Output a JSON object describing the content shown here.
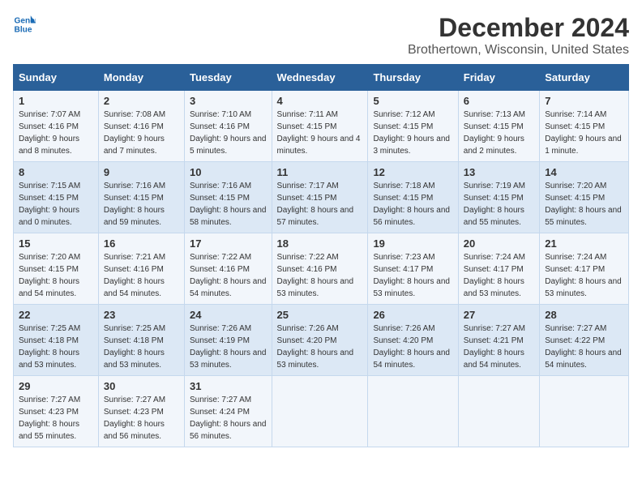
{
  "header": {
    "logo_line1": "General",
    "logo_line2": "Blue",
    "title": "December 2024",
    "subtitle": "Brothertown, Wisconsin, United States"
  },
  "days_of_week": [
    "Sunday",
    "Monday",
    "Tuesday",
    "Wednesday",
    "Thursday",
    "Friday",
    "Saturday"
  ],
  "weeks": [
    [
      {
        "day": "1",
        "sunrise": "7:07 AM",
        "sunset": "4:16 PM",
        "daylight": "9 hours and 8 minutes."
      },
      {
        "day": "2",
        "sunrise": "7:08 AM",
        "sunset": "4:16 PM",
        "daylight": "9 hours and 7 minutes."
      },
      {
        "day": "3",
        "sunrise": "7:10 AM",
        "sunset": "4:16 PM",
        "daylight": "9 hours and 5 minutes."
      },
      {
        "day": "4",
        "sunrise": "7:11 AM",
        "sunset": "4:15 PM",
        "daylight": "9 hours and 4 minutes."
      },
      {
        "day": "5",
        "sunrise": "7:12 AM",
        "sunset": "4:15 PM",
        "daylight": "9 hours and 3 minutes."
      },
      {
        "day": "6",
        "sunrise": "7:13 AM",
        "sunset": "4:15 PM",
        "daylight": "9 hours and 2 minutes."
      },
      {
        "day": "7",
        "sunrise": "7:14 AM",
        "sunset": "4:15 PM",
        "daylight": "9 hours and 1 minute."
      }
    ],
    [
      {
        "day": "8",
        "sunrise": "7:15 AM",
        "sunset": "4:15 PM",
        "daylight": "9 hours and 0 minutes."
      },
      {
        "day": "9",
        "sunrise": "7:16 AM",
        "sunset": "4:15 PM",
        "daylight": "8 hours and 59 minutes."
      },
      {
        "day": "10",
        "sunrise": "7:16 AM",
        "sunset": "4:15 PM",
        "daylight": "8 hours and 58 minutes."
      },
      {
        "day": "11",
        "sunrise": "7:17 AM",
        "sunset": "4:15 PM",
        "daylight": "8 hours and 57 minutes."
      },
      {
        "day": "12",
        "sunrise": "7:18 AM",
        "sunset": "4:15 PM",
        "daylight": "8 hours and 56 minutes."
      },
      {
        "day": "13",
        "sunrise": "7:19 AM",
        "sunset": "4:15 PM",
        "daylight": "8 hours and 55 minutes."
      },
      {
        "day": "14",
        "sunrise": "7:20 AM",
        "sunset": "4:15 PM",
        "daylight": "8 hours and 55 minutes."
      }
    ],
    [
      {
        "day": "15",
        "sunrise": "7:20 AM",
        "sunset": "4:15 PM",
        "daylight": "8 hours and 54 minutes."
      },
      {
        "day": "16",
        "sunrise": "7:21 AM",
        "sunset": "4:16 PM",
        "daylight": "8 hours and 54 minutes."
      },
      {
        "day": "17",
        "sunrise": "7:22 AM",
        "sunset": "4:16 PM",
        "daylight": "8 hours and 54 minutes."
      },
      {
        "day": "18",
        "sunrise": "7:22 AM",
        "sunset": "4:16 PM",
        "daylight": "8 hours and 53 minutes."
      },
      {
        "day": "19",
        "sunrise": "7:23 AM",
        "sunset": "4:17 PM",
        "daylight": "8 hours and 53 minutes."
      },
      {
        "day": "20",
        "sunrise": "7:24 AM",
        "sunset": "4:17 PM",
        "daylight": "8 hours and 53 minutes."
      },
      {
        "day": "21",
        "sunrise": "7:24 AM",
        "sunset": "4:17 PM",
        "daylight": "8 hours and 53 minutes."
      }
    ],
    [
      {
        "day": "22",
        "sunrise": "7:25 AM",
        "sunset": "4:18 PM",
        "daylight": "8 hours and 53 minutes."
      },
      {
        "day": "23",
        "sunrise": "7:25 AM",
        "sunset": "4:18 PM",
        "daylight": "8 hours and 53 minutes."
      },
      {
        "day": "24",
        "sunrise": "7:26 AM",
        "sunset": "4:19 PM",
        "daylight": "8 hours and 53 minutes."
      },
      {
        "day": "25",
        "sunrise": "7:26 AM",
        "sunset": "4:20 PM",
        "daylight": "8 hours and 53 minutes."
      },
      {
        "day": "26",
        "sunrise": "7:26 AM",
        "sunset": "4:20 PM",
        "daylight": "8 hours and 54 minutes."
      },
      {
        "day": "27",
        "sunrise": "7:27 AM",
        "sunset": "4:21 PM",
        "daylight": "8 hours and 54 minutes."
      },
      {
        "day": "28",
        "sunrise": "7:27 AM",
        "sunset": "4:22 PM",
        "daylight": "8 hours and 54 minutes."
      }
    ],
    [
      {
        "day": "29",
        "sunrise": "7:27 AM",
        "sunset": "4:23 PM",
        "daylight": "8 hours and 55 minutes."
      },
      {
        "day": "30",
        "sunrise": "7:27 AM",
        "sunset": "4:23 PM",
        "daylight": "8 hours and 56 minutes."
      },
      {
        "day": "31",
        "sunrise": "7:27 AM",
        "sunset": "4:24 PM",
        "daylight": "8 hours and 56 minutes."
      },
      null,
      null,
      null,
      null
    ]
  ]
}
